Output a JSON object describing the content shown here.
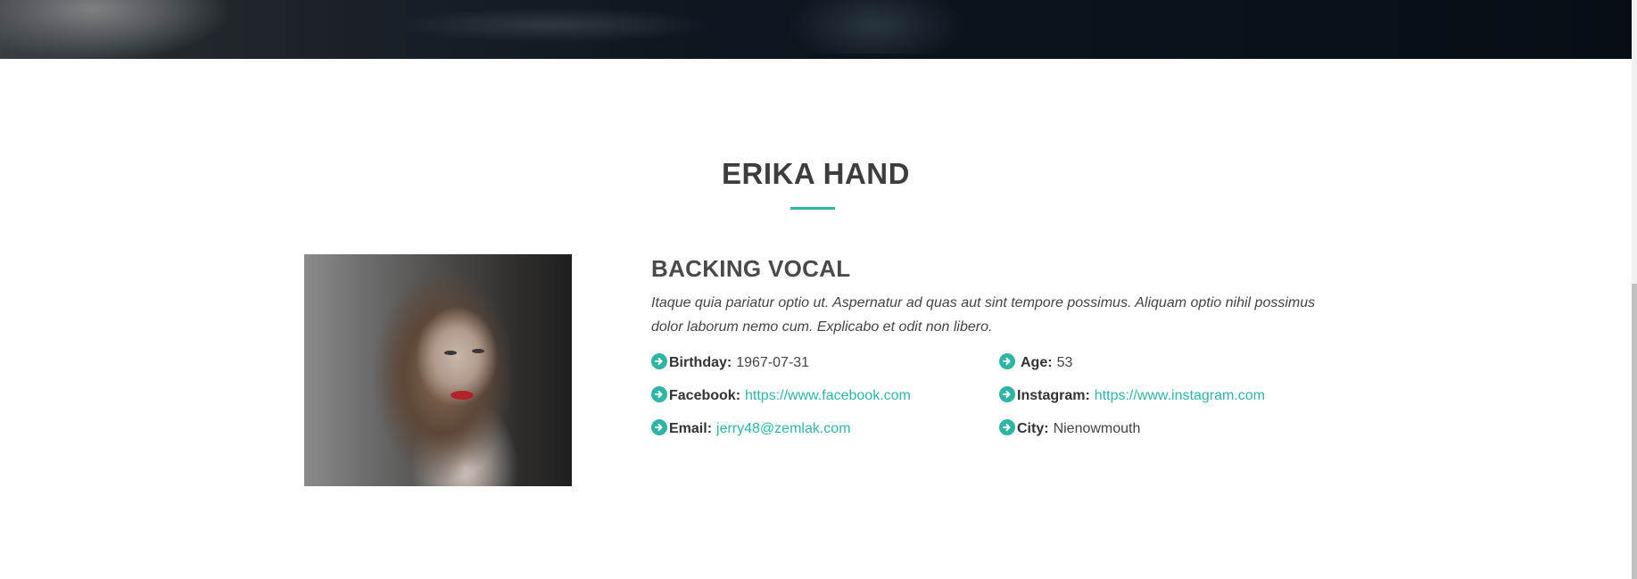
{
  "profile": {
    "name": "ERIKA HAND",
    "role": "BACKING VOCAL",
    "bio": "Itaque quia pariatur optio ut. Aspernatur ad quas aut sint tempore possimus. Aliquam optio nihil possimus dolor laborum nemo cum. Explicabo et odit non libero.",
    "details": {
      "birthday": {
        "label": "Birthday:",
        "value": "1967-07-31"
      },
      "age": {
        "label": "Age:",
        "value": "53"
      },
      "facebook": {
        "label": "Facebook:",
        "value": "https://www.facebook.com"
      },
      "instagram": {
        "label": "Instagram:",
        "value": "https://www.instagram.com"
      },
      "email": {
        "label": "Email:",
        "value": "jerry48@zemlak.com"
      },
      "city": {
        "label": "City:",
        "value": "Nienowmouth"
      }
    }
  },
  "icons": {
    "detail_bullet": "arrow-circle-right-icon"
  },
  "colors": {
    "accent": "#2fb5a4",
    "heading": "#3d3d3d",
    "text": "#444444"
  }
}
